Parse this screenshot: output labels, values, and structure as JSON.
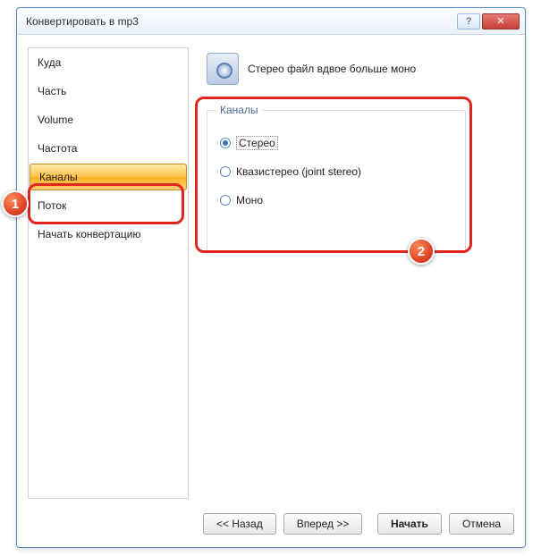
{
  "window": {
    "title": "Конвертировать в mp3"
  },
  "sidebar": {
    "items": [
      {
        "label": "Куда",
        "selected": false
      },
      {
        "label": "Часть",
        "selected": false
      },
      {
        "label": "Volume",
        "selected": false
      },
      {
        "label": "Частота",
        "selected": false
      },
      {
        "label": "Каналы",
        "selected": true
      },
      {
        "label": "Поток",
        "selected": false
      },
      {
        "label": "Начать конвертацию",
        "selected": false
      }
    ]
  },
  "main": {
    "description": "Стерео файл вдвое больше моно",
    "group": {
      "legend": "Каналы",
      "options": [
        {
          "label": "Стерео",
          "checked": true
        },
        {
          "label": "Квазистерео (joint stereo)",
          "checked": false
        },
        {
          "label": "Моно",
          "checked": false
        }
      ]
    }
  },
  "buttons": {
    "back": "<< Назад",
    "forward": "Вперед >>",
    "start": "Начать",
    "cancel": "Отмена"
  },
  "annotations": {
    "marker1": "1",
    "marker2": "2"
  }
}
